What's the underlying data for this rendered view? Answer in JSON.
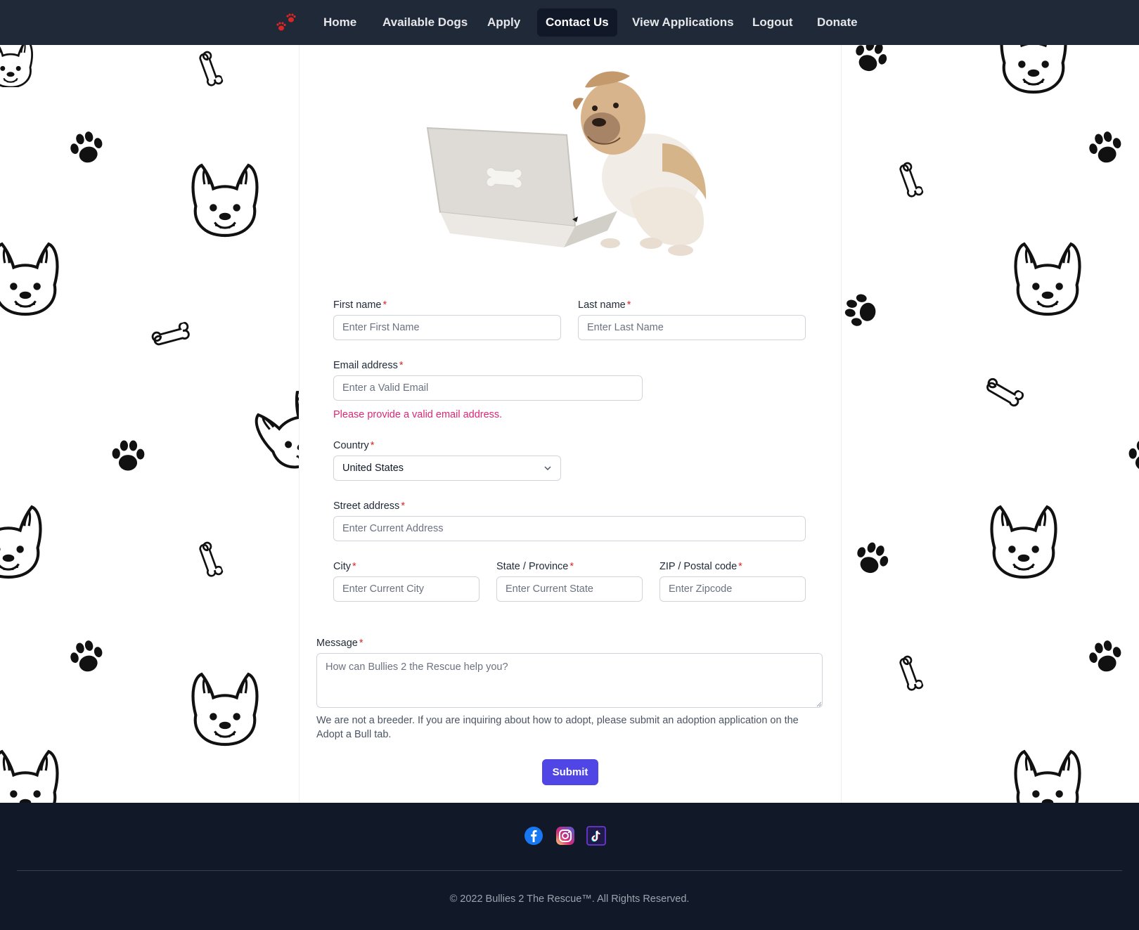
{
  "nav": {
    "logo_icon": "paw-prints-icon",
    "items": [
      {
        "label": "Home",
        "active": false
      },
      {
        "label": "Available Dogs",
        "active": false
      },
      {
        "label": "Apply",
        "active": false
      },
      {
        "label": "Contact Us",
        "active": true
      },
      {
        "label": "View Applications",
        "active": false
      },
      {
        "label": "Logout",
        "active": false
      },
      {
        "label": "Donate",
        "active": false
      }
    ]
  },
  "hero": {
    "image": "bulldog-with-laptop"
  },
  "form": {
    "first_name": {
      "label": "First name",
      "required": "*",
      "placeholder": "Enter First Name",
      "value": ""
    },
    "last_name": {
      "label": "Last name",
      "required": "*",
      "placeholder": "Enter Last Name",
      "value": ""
    },
    "email": {
      "label": "Email address",
      "required": "*",
      "placeholder": "Enter a Valid Email",
      "value": "",
      "error": "Please provide a valid email address."
    },
    "country": {
      "label": "Country",
      "required": "*",
      "value": "United States"
    },
    "street": {
      "label": "Street address",
      "required": "*",
      "placeholder": "Enter Current Address",
      "value": ""
    },
    "city": {
      "label": "City",
      "required": "*",
      "placeholder": "Enter Current City",
      "value": ""
    },
    "state": {
      "label": "State / Province",
      "required": "*",
      "placeholder": "Enter Current State",
      "value": ""
    },
    "zip": {
      "label": "ZIP / Postal code",
      "required": "*",
      "placeholder": "Enter Zipcode",
      "value": ""
    },
    "message": {
      "label": "Message",
      "required": "*",
      "placeholder": "How can Bullies 2 the Rescue help you?",
      "value": ""
    },
    "help_text": "We are not a breeder. If you are inquiring about how to adopt, please submit an adoption application on the Adopt a Bull tab.",
    "submit_label": "Submit"
  },
  "footer": {
    "social": [
      {
        "icon": "facebook-icon"
      },
      {
        "icon": "instagram-icon"
      },
      {
        "icon": "tiktok-icon"
      }
    ],
    "copyright": "© 2022 Bullies 2 The Rescue™. All Rights Reserved."
  },
  "colors": {
    "nav_bg": "#1f2937",
    "footer_bg": "#111827",
    "accent": "#4f46e5",
    "required": "#dc2626",
    "error": "#db2777"
  }
}
